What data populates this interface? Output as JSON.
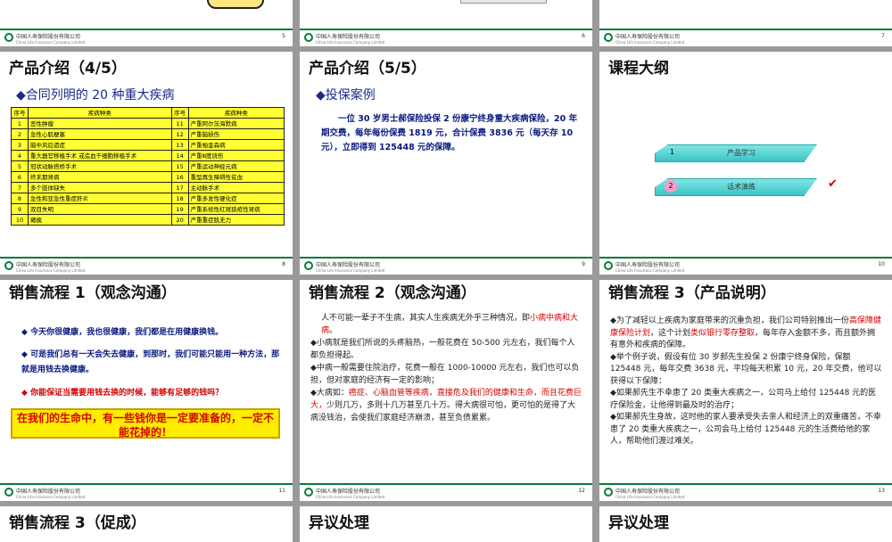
{
  "slides": {
    "s5": {
      "num": "5"
    },
    "s6": {
      "num": "6"
    },
    "s7": {
      "num": "7"
    },
    "s8": {
      "title": "产品介绍（4/5）",
      "subtitle": "◆合同列明的 20 种重大疾病",
      "headers": [
        "序号",
        "疾病种类",
        "序号",
        "疾病种类"
      ],
      "rows": [
        [
          "1",
          "恶性肿瘤",
          "11",
          "严重阿尔茨海默病"
        ],
        [
          "2",
          "急性心肌梗塞",
          "12",
          "严重脑损伤"
        ],
        [
          "3",
          "脑中风后遗症",
          "13",
          "严重帕金森病"
        ],
        [
          "4",
          "重大器官移植手术 或造血干细胞移植手术",
          "14",
          "严重Ⅲ度烧伤"
        ],
        [
          "5",
          "冠状动脉搭桥手术",
          "15",
          "严重运动神经元病"
        ],
        [
          "6",
          "终末期肾病",
          "16",
          "重型再生障碍性贫血"
        ],
        [
          "7",
          "多个肢体缺失",
          "17",
          "主动脉手术"
        ],
        [
          "8",
          "急性和亚急性重症肝炎",
          "18",
          "严重多发性硬化症"
        ],
        [
          "9",
          "双目失明",
          "19",
          "严重系统性红斑狼疮性肾病"
        ],
        [
          "10",
          "瘫痪",
          "20",
          "严重重症肌无力"
        ]
      ],
      "num": "8"
    },
    "s9": {
      "title": "产品介绍（5/5）",
      "subtitle": "◆投保案例",
      "body": "一位 30 岁男士郝保险投保 2 份康宁终身重大疾病保险，20 年期交费，每年每份保费 1819 元，合计保费 3836 元（每天存 10 元），立即得到 125448 元的保障。",
      "num": "9"
    },
    "s10": {
      "title": "课程大纲",
      "item1_num": "1",
      "item1_label": "产品学习",
      "item2_num": "2",
      "item2_label": "话术演练",
      "check": "✔",
      "num": "10"
    },
    "s11": {
      "title": "销售流程 1（观念沟通）",
      "b1": "今天你很健康，我也很健康，我们都是在用健康换钱。",
      "b2": "可是我们总有一天会失去健康，到那时，我们可能只能用一种方法，那就是用钱去换健康。",
      "b3": "你能保证当需要用钱去换的时候，能够有足够的钱吗？",
      "banner": "在我们的生命中，有一些钱你是一定要准备的，一定不能花掉的！",
      "num": "11"
    },
    "s12": {
      "title": "销售流程 2（观念沟通）",
      "p1a": "人不可能一辈子不生病，其实人生疾病无外乎三种情况，即",
      "p1b": "小病中病和大病",
      "p1c": "。",
      "p2": "◆小病就是我们所说的头疼脑热，一般花费在 50-500 元左右，我们每个人都负担得起。",
      "p3": "◆中病一般需要住院治疗，花费一般在 1000-10000 元左右，我们也可以负担，但对家庭的经济有一定的影响；",
      "p4a": "◆大病如：",
      "p4b": "癌症、心脑血管等疾病，直接危及我们的健康和生命，而且花费巨大，",
      "p4c": "少则几万，多则十几万甚至几十万。得大病很可怕，更可怕的是得了大病没钱治，会使我们家庭经济崩溃，甚至负债累累。",
      "num": "12"
    },
    "s13": {
      "title": "销售流程 3（产品说明）",
      "p1a": "◆为了减轻以上疾病为家庭带来的沉重负担，我们公司特别推出一份",
      "p1b": "高保障健康保险计划",
      "p1c": "，这个计划",
      "p1d": "类似银行零存整取",
      "p1e": "，每年存入金额不多，而且额外拥有意外和疾病的保障。",
      "p2": "◆举个例子说，假设有位 30 岁郝先生投保 2 份康宁终身保险，保额 125448 元，每年交费 3638 元，平均每天积累 10 元，20 年交费，他可以获得以下保障：",
      "p3": "◆如果郝先生不幸患了 20 类重大疾病之一，公司马上给付 125448 元的医疗保险金，让他得到最及时的治疗；",
      "p4": "◆如果郝先生身故，这时他的家人要承受失去亲人和经济上的双重痛苦，不幸患了 20 类重大疾病之一，公司会马上给付 125448 元的生活费给他的家人，帮助他们渡过难关。",
      "num": "13"
    },
    "s14": {
      "title": "销售流程 3（促成）"
    },
    "s15": {
      "title": "异议处理"
    },
    "s16": {
      "title": "异议处理"
    },
    "company": "中国人寿保险股份有限公司",
    "company_en": "China Life Insurance Company Limited"
  }
}
